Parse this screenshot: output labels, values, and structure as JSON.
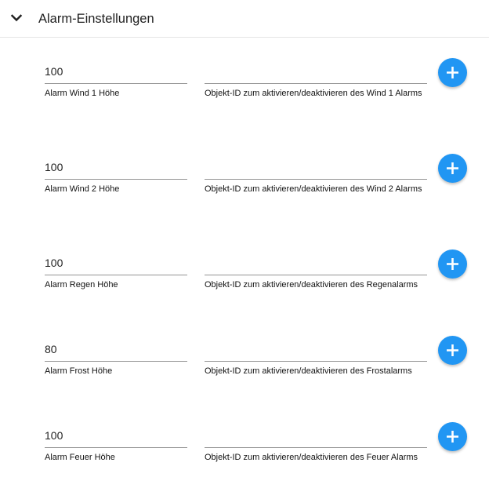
{
  "section": {
    "title": "Alarm-Einstellungen",
    "expanded": true,
    "chevron_icon": "chevron-down-icon"
  },
  "accent_color": "#2196f3",
  "alarms": [
    {
      "value": "100",
      "value_label": "Alarm Wind 1 Höhe",
      "object_id": "",
      "object_id_label": "Objekt-ID zum aktivieren/deaktivieren des Wind 1 Alarms",
      "add_icon": "plus-icon"
    },
    {
      "value": "100",
      "value_label": "Alarm Wind 2 Höhe",
      "object_id": "",
      "object_id_label": "Objekt-ID zum aktivieren/deaktivieren des Wind 2 Alarms",
      "add_icon": "plus-icon"
    },
    {
      "value": "100",
      "value_label": "Alarm Regen Höhe",
      "object_id": "",
      "object_id_label": "Objekt-ID zum aktivieren/deaktivieren des Regenalarms",
      "add_icon": "plus-icon"
    },
    {
      "value": "80",
      "value_label": "Alarm Frost Höhe",
      "object_id": "",
      "object_id_label": "Objekt-ID zum aktivieren/deaktivieren des Frostalarms",
      "add_icon": "plus-icon"
    },
    {
      "value": "100",
      "value_label": "Alarm Feuer Höhe",
      "object_id": "",
      "object_id_label": "Objekt-ID zum aktivieren/deaktivieren des Feuer Alarms",
      "add_icon": "plus-icon"
    }
  ]
}
